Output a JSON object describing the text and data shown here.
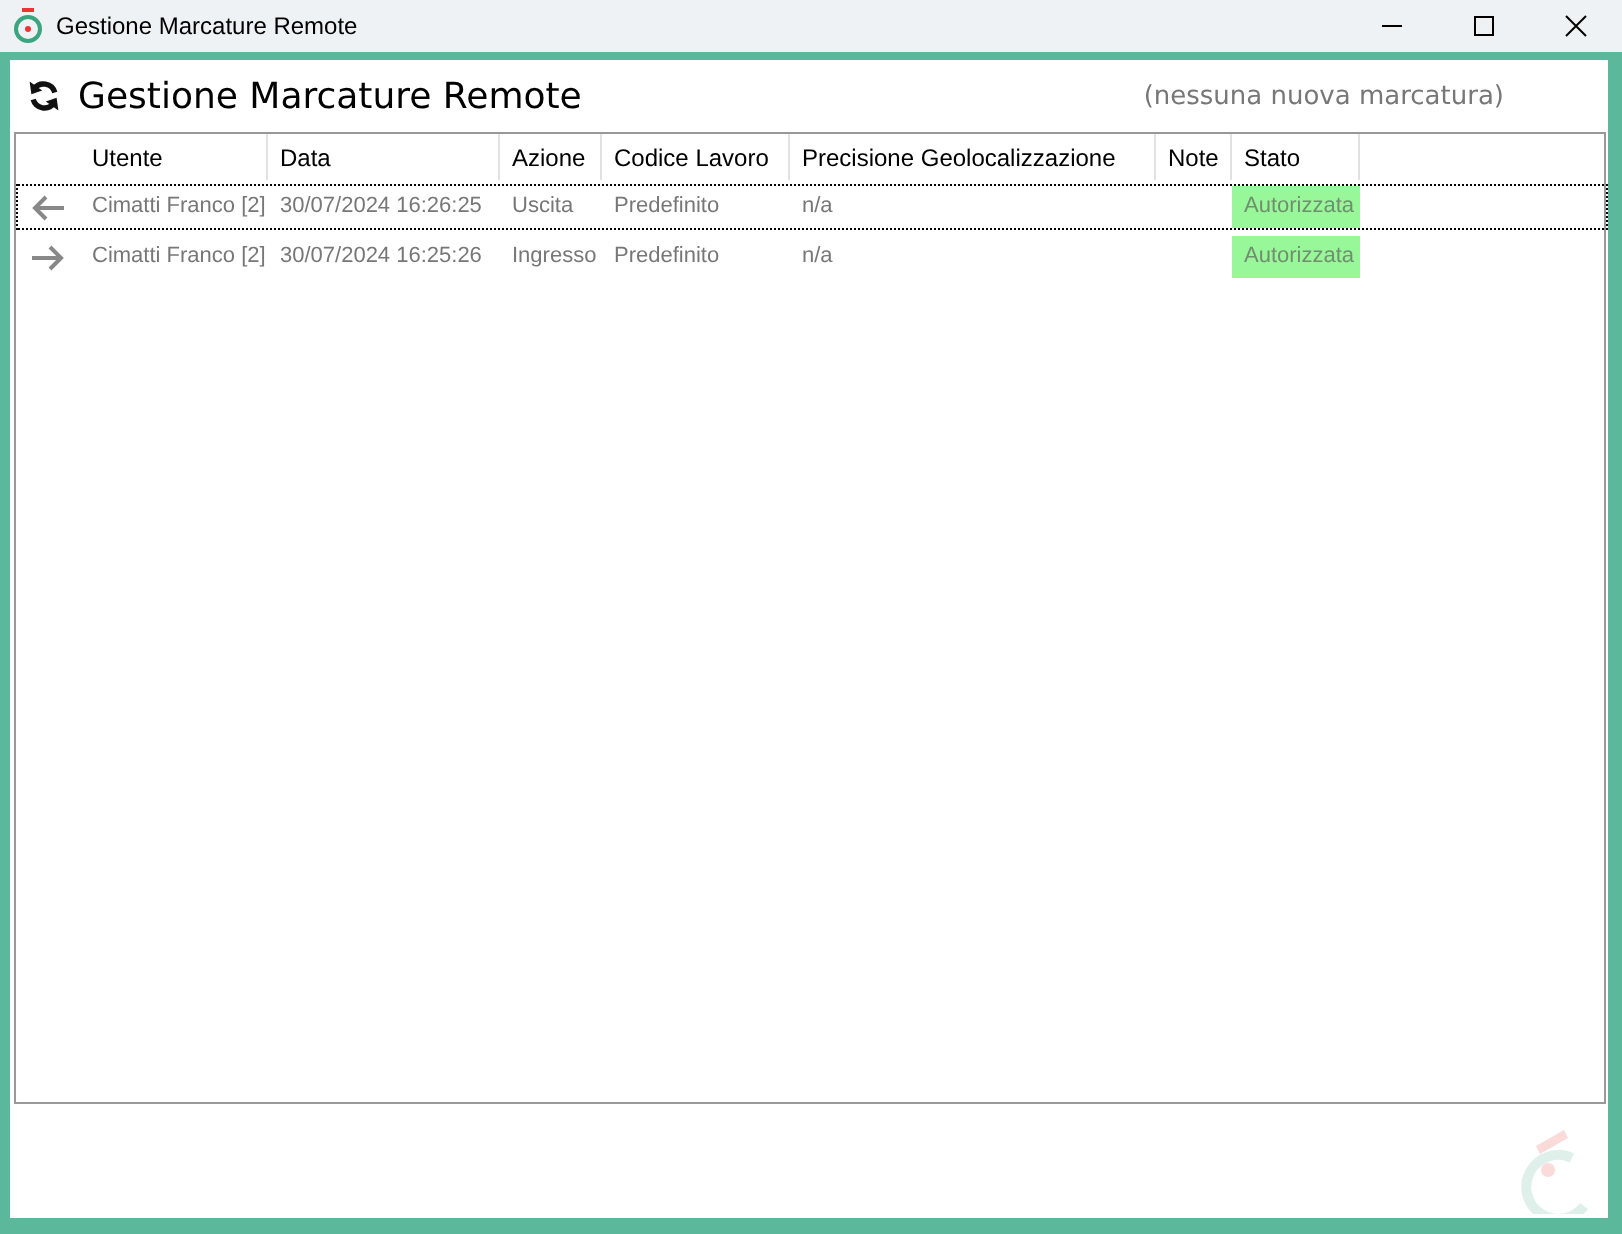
{
  "window": {
    "title": "Gestione Marcature Remote"
  },
  "header": {
    "title": "Gestione Marcature Remote",
    "notice": "(nessuna nuova marcatura)"
  },
  "table": {
    "columns": [
      "Utente",
      "Data",
      "Azione",
      "Codice Lavoro",
      "Precisione Geolocalizzazione",
      "Note",
      "Stato"
    ],
    "rows": [
      {
        "kind": "exit",
        "selected": true,
        "cells": [
          "Cimatti Franco [2]",
          "30/07/2024 16:26:25",
          "Uscita",
          "Predefinito",
          "n/a",
          "",
          "Autorizzata"
        ]
      },
      {
        "kind": "entry",
        "selected": false,
        "cells": [
          "Cimatti Franco [2]",
          "30/07/2024 16:25:26",
          "Ingresso",
          "Predefinito",
          "n/a",
          "",
          "Autorizzata"
        ]
      }
    ]
  }
}
